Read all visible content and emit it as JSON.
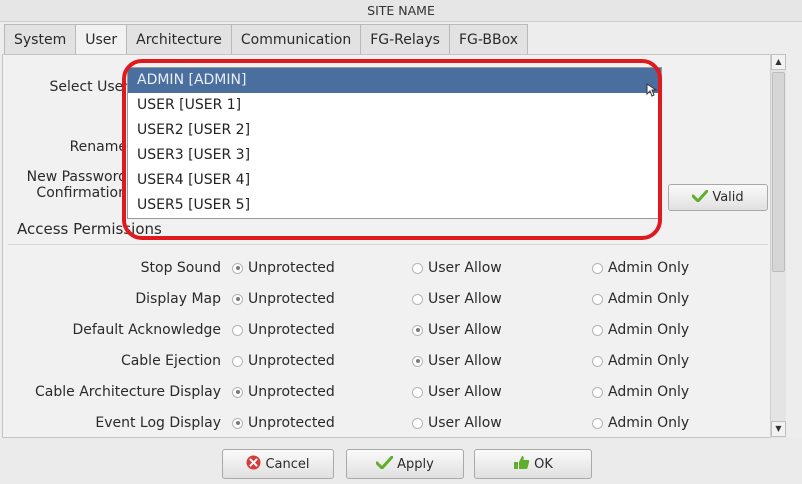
{
  "window": {
    "title": "SITE NAME"
  },
  "tabs": [
    {
      "label": "System"
    },
    {
      "label": "User",
      "active": true
    },
    {
      "label": "Architecture"
    },
    {
      "label": "Communication"
    },
    {
      "label": "FG-Relays"
    },
    {
      "label": "FG-BBox"
    }
  ],
  "user_form": {
    "select_user_label": "Select User",
    "rename_label": "Rename",
    "new_password_label": "New Password",
    "confirmation_label": "Confirmation",
    "valid_button": "Valid"
  },
  "user_dropdown": {
    "options": [
      {
        "label": "ADMIN [ADMIN]",
        "selected": true
      },
      {
        "label": "USER [USER 1]"
      },
      {
        "label": "USER2 [USER 2]"
      },
      {
        "label": "USER3 [USER 3]"
      },
      {
        "label": "USER4 [USER 4]"
      },
      {
        "label": "USER5 [USER 5]"
      }
    ]
  },
  "access_permissions": {
    "title": "Access Permissions",
    "option_labels": [
      "Unprotected",
      "User Allow",
      "Admin Only"
    ],
    "rows": [
      {
        "label": "Stop Sound",
        "selected": "Unprotected"
      },
      {
        "label": "Display Map",
        "selected": "Unprotected"
      },
      {
        "label": "Default Acknowledge",
        "selected": "User Allow"
      },
      {
        "label": "Cable Ejection",
        "selected": "User Allow"
      },
      {
        "label": "Cable Architecture Display",
        "selected": "Unprotected"
      },
      {
        "label": "Event Log Display",
        "selected": "Unprotected"
      }
    ]
  },
  "footer": {
    "cancel": "Cancel",
    "apply": "Apply",
    "ok": "OK"
  },
  "colors": {
    "selection": "#4a6f9e",
    "highlight_ring": "#e0191e",
    "cancel_icon": "#d93a3a",
    "check_icon": "#5fae2e"
  },
  "icons": {
    "valid": "check-icon",
    "cancel": "cancel-icon",
    "apply": "check-icon",
    "ok": "ok-thumb-icon"
  }
}
